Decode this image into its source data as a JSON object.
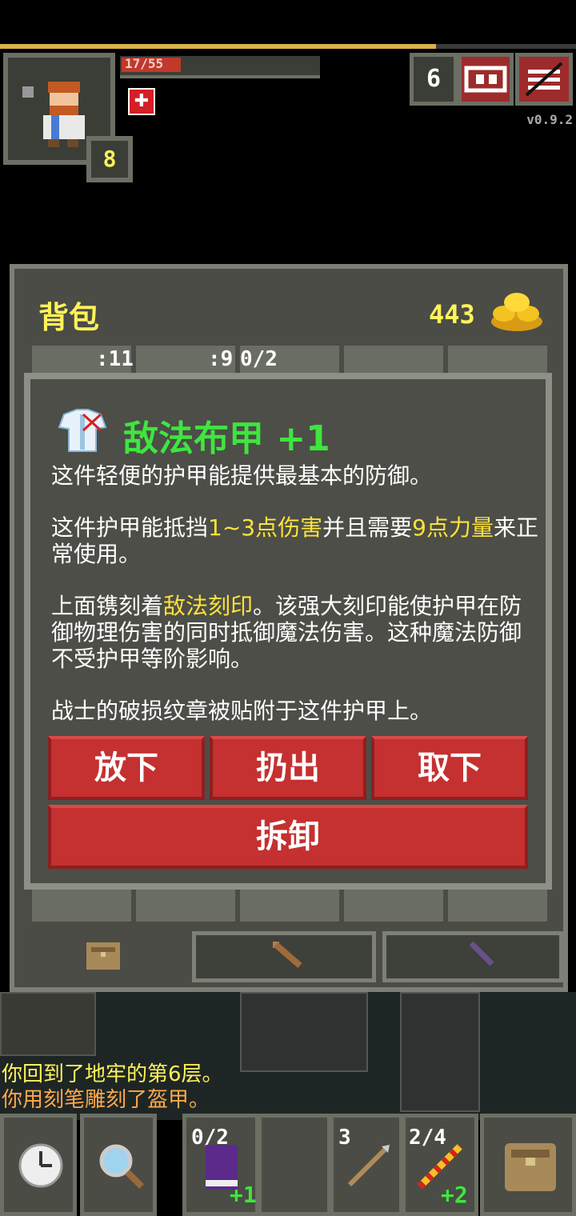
{
  "status": {
    "hp_text": "17/55",
    "level": "8",
    "depth": "6",
    "version": "v0.9.2"
  },
  "inventory": {
    "title": "背包",
    "gold": "443",
    "tab_counts": [
      ":11",
      ":9",
      "0/2"
    ]
  },
  "item": {
    "name": "敌法布甲 +1",
    "desc_1": "这件轻便的护甲能提供最基本的防御。",
    "desc_2a": "这件护甲能抵挡",
    "desc_2b": "1~3点伤害",
    "desc_2c": "并且需要",
    "desc_2d": "9点力量",
    "desc_2e": "来正常使用。",
    "desc_3a": "上面镌刻着",
    "desc_3b": "敌法刻印",
    "desc_3c": "。该强大刻印能使护甲在防御物理伤害的同时抵御魔法伤害。这种魔法防御不受护甲等阶影响。",
    "desc_4": "战士的破损纹章被贴附于这件护甲上。"
  },
  "actions": {
    "drop": "放下",
    "throw": "扔出",
    "unequip": "取下",
    "detach": "拆卸"
  },
  "log": {
    "line1": "你回到了地牢的第6层。",
    "line2": "你用刻笔雕刻了盔甲。"
  },
  "quickslots": [
    {
      "count": "0/2",
      "bonus": "+1"
    },
    {
      "count": "",
      "bonus": ""
    },
    {
      "count": "3",
      "bonus": ""
    },
    {
      "count": "2/4",
      "bonus": "+2"
    }
  ]
}
